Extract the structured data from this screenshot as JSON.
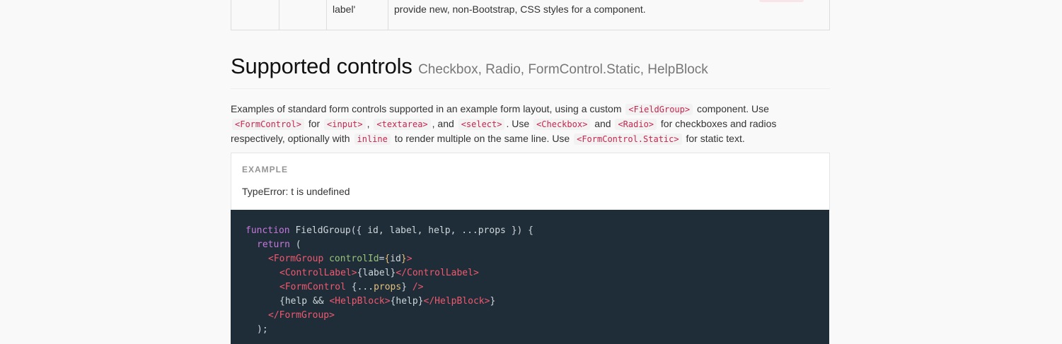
{
  "table_tail": {
    "label_cell": "label'",
    "description": "provide new, non-Bootstrap, CSS styles for a component."
  },
  "section": {
    "title": "Supported controls",
    "subtitle": "Checkbox, Radio, FormControl.Static, HelpBlock"
  },
  "description": {
    "t1": "Examples of standard form controls supported in an example form layout, using a custom",
    "c1": "<FieldGroup>",
    "t2": "component. Use",
    "c2": "<FormControl>",
    "t3": "for",
    "c3": "<input>",
    "t4": ",",
    "c4": "<textarea>",
    "t5": ", and",
    "c5": "<select>",
    "t6": ". Use",
    "c6": "<Checkbox>",
    "t7": "and",
    "c7": "<Radio>",
    "t8": "for checkboxes and radios respectively, optionally with",
    "c8": "inline",
    "t9": "to render multiple on the same line. Use",
    "c9": "<FormControl.Static>",
    "t10": "for static text."
  },
  "example": {
    "label": "EXAMPLE",
    "error": "TypeError: t is undefined"
  },
  "code": {
    "l1_kw": "function",
    "l1_rest": " FieldGroup({ id, label, help, ...props }) {",
    "l2_kw": "return",
    "l2_rest": " (",
    "l3_tag": "<FormGroup",
    "l3_attr": "controlId",
    "l3_eq": "=",
    "l3_br1": "{",
    "l3_val": "id",
    "l3_br2": "}",
    "l3_close": ">",
    "l4_tag1": "<ControlLabel>",
    "l4_val": "{label}",
    "l4_tag2": "</ControlLabel>",
    "l5_tag": "<FormControl",
    "l5_spread": " {...",
    "l5_props": "props",
    "l5_end": "} ",
    "l5_close": "/>",
    "l6_a": "{help && ",
    "l6_tag1": "<HelpBlock>",
    "l6_val": "{help}",
    "l6_tag2": "</HelpBlock>",
    "l6_b": "}",
    "l7_tag": "</FormGroup>",
    "l8": ");"
  }
}
